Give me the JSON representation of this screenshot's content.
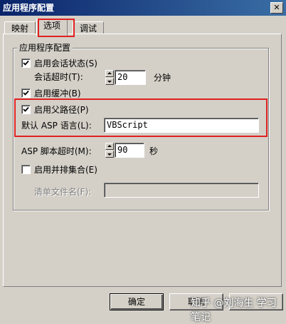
{
  "window": {
    "title": "应用程序配置",
    "close_glyph": "✕"
  },
  "tabs": [
    {
      "label": "映射"
    },
    {
      "label": "选项"
    },
    {
      "label": "调试"
    }
  ],
  "group": {
    "title": "应用程序配置",
    "enable_session_state": {
      "label": "启用会话状态(S)",
      "checked": true
    },
    "session_timeout": {
      "label": "会话超时(T):",
      "value": "20",
      "unit": "分钟"
    },
    "enable_buffering": {
      "label": "启用缓冲(B)",
      "checked": true
    },
    "enable_parent_paths": {
      "label": "启用父路径(P)",
      "checked": true
    },
    "default_asp_language": {
      "label": "默认 ASP 语言(L):",
      "value": "VBScript"
    },
    "asp_script_timeout": {
      "label": "ASP 脚本超时(M):",
      "value": "90",
      "unit": "秒"
    },
    "enable_side_by_side": {
      "label": "启用并排集合(E)",
      "checked": false
    },
    "manifest_file_name": {
      "label": "清单文件名(F):",
      "value": ""
    }
  },
  "buttons": {
    "ok": "确定",
    "cancel": "取消"
  },
  "watermark": "知乎 @刘海生 学习笔记",
  "colors": {
    "highlight": "#e02020",
    "titlebar": "#0a246a"
  }
}
